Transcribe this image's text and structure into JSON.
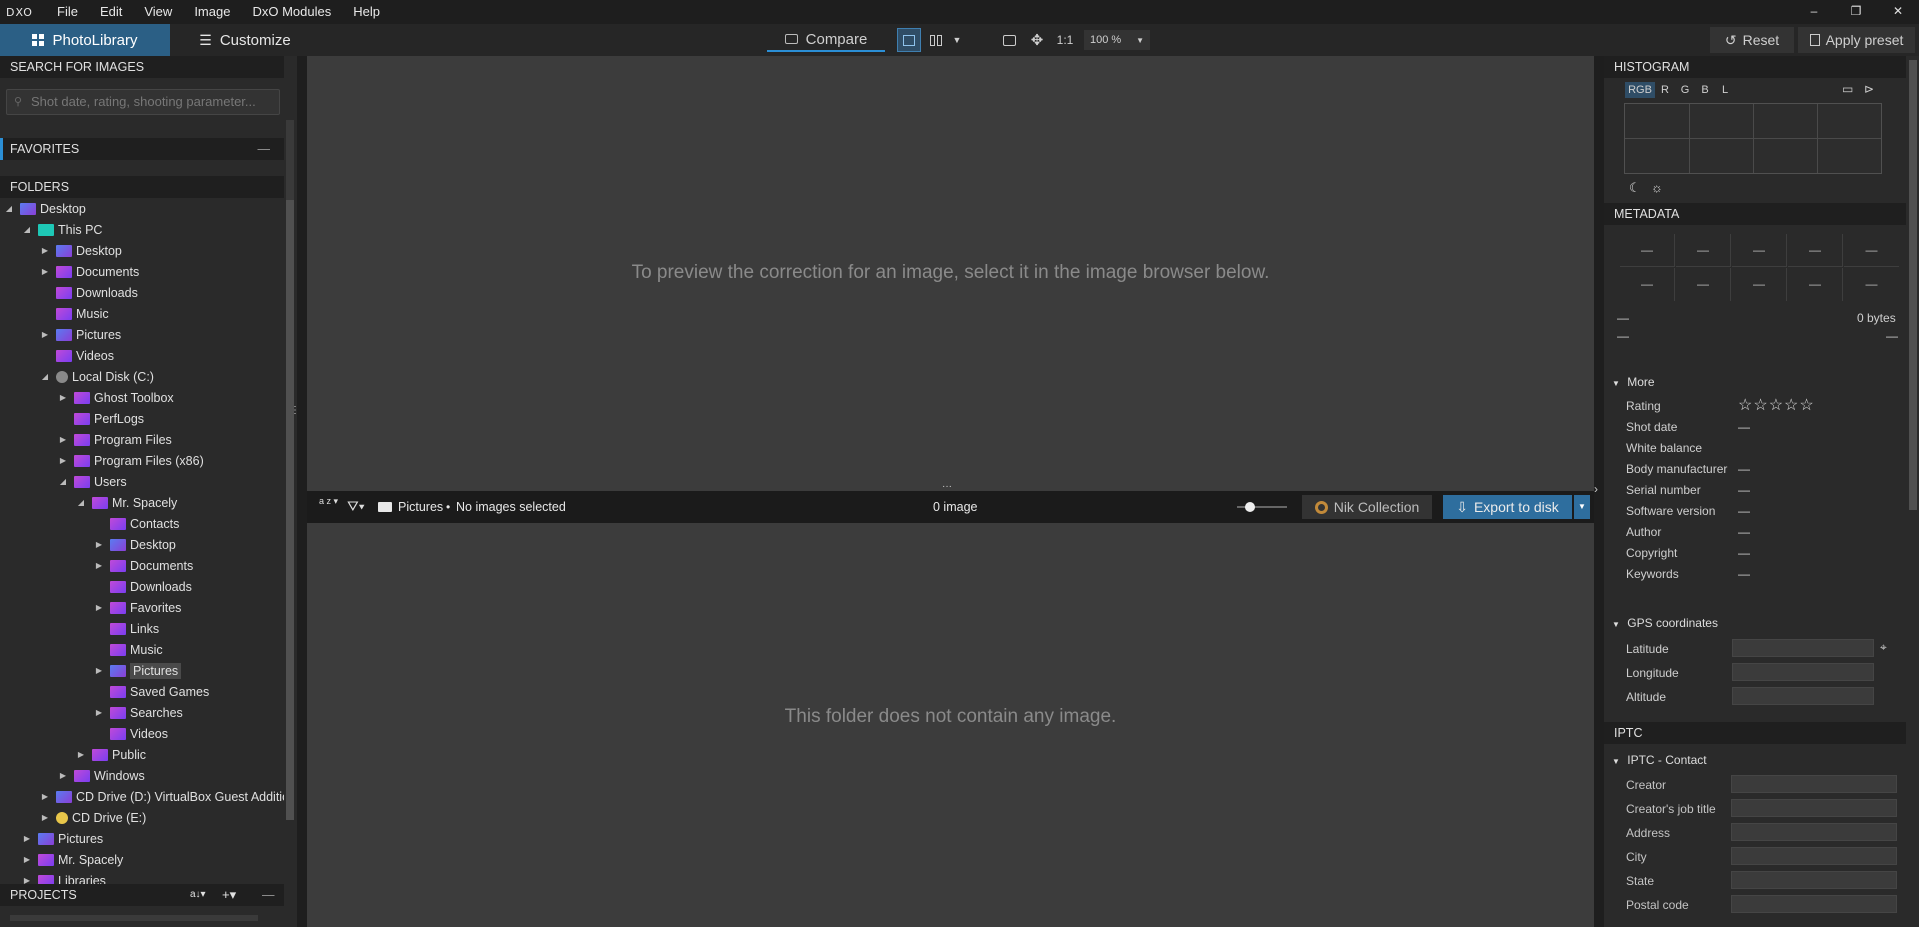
{
  "menubar": {
    "logo": "DXO",
    "items": [
      "File",
      "Edit",
      "View",
      "Image",
      "DxO Modules",
      "Help"
    ],
    "window_controls": [
      "–",
      "❐",
      "✕"
    ]
  },
  "toolbar": {
    "tab_photolibrary": "PhotoLibrary",
    "tab_customize": "Customize",
    "compare_label": "Compare",
    "zoom_one_to_one": "1:1",
    "zoom_value": "100 %",
    "reset_label": "Reset",
    "apply_preset_label": "Apply preset"
  },
  "left_panel": {
    "search_header": "SEARCH FOR IMAGES",
    "search_placeholder": "Shot date, rating, shooting parameter...",
    "favorites_header": "FAVORITES",
    "folders_header": "FOLDERS",
    "projects_header": "PROJECTS",
    "tree": [
      {
        "label": "Desktop",
        "level": 0,
        "arrow": "down",
        "icon": "blue"
      },
      {
        "label": "This PC",
        "level": 1,
        "arrow": "down",
        "icon": "teal"
      },
      {
        "label": "Desktop",
        "level": 2,
        "arrow": "right",
        "icon": "blue"
      },
      {
        "label": "Documents",
        "level": 2,
        "arrow": "right",
        "icon": "mag"
      },
      {
        "label": "Downloads",
        "level": 2,
        "arrow": "",
        "icon": "mag"
      },
      {
        "label": "Music",
        "level": 2,
        "arrow": "",
        "icon": "mag"
      },
      {
        "label": "Pictures",
        "level": 2,
        "arrow": "right",
        "icon": "blue"
      },
      {
        "label": "Videos",
        "level": 2,
        "arrow": "",
        "icon": "mag"
      },
      {
        "label": "Local Disk (C:)",
        "level": 2,
        "arrow": "down",
        "icon": "grey"
      },
      {
        "label": "Ghost Toolbox",
        "level": 3,
        "arrow": "right",
        "icon": "mag"
      },
      {
        "label": "PerfLogs",
        "level": 3,
        "arrow": "",
        "icon": "mag"
      },
      {
        "label": "Program Files",
        "level": 3,
        "arrow": "right",
        "icon": "mag"
      },
      {
        "label": "Program Files (x86)",
        "level": 3,
        "arrow": "right",
        "icon": "mag"
      },
      {
        "label": "Users",
        "level": 3,
        "arrow": "down",
        "icon": "mag"
      },
      {
        "label": "Mr. Spacely",
        "level": 4,
        "arrow": "down",
        "icon": "mag"
      },
      {
        "label": "Contacts",
        "level": 5,
        "arrow": "",
        "icon": "mag"
      },
      {
        "label": "Desktop",
        "level": 5,
        "arrow": "right",
        "icon": "blue"
      },
      {
        "label": "Documents",
        "level": 5,
        "arrow": "right",
        "icon": "mag"
      },
      {
        "label": "Downloads",
        "level": 5,
        "arrow": "",
        "icon": "mag"
      },
      {
        "label": "Favorites",
        "level": 5,
        "arrow": "right",
        "icon": "mag"
      },
      {
        "label": "Links",
        "level": 5,
        "arrow": "",
        "icon": "mag"
      },
      {
        "label": "Music",
        "level": 5,
        "arrow": "",
        "icon": "mag"
      },
      {
        "label": "Pictures",
        "level": 5,
        "arrow": "right",
        "icon": "blue",
        "selected": true
      },
      {
        "label": "Saved Games",
        "level": 5,
        "arrow": "",
        "icon": "mag"
      },
      {
        "label": "Searches",
        "level": 5,
        "arrow": "right",
        "icon": "mag"
      },
      {
        "label": "Videos",
        "level": 5,
        "arrow": "",
        "icon": "mag"
      },
      {
        "label": "Public",
        "level": 4,
        "arrow": "right",
        "icon": "mag"
      },
      {
        "label": "Windows",
        "level": 3,
        "arrow": "right",
        "icon": "mag"
      },
      {
        "label": "CD Drive (D:) VirtualBox Guest Addition",
        "level": 2,
        "arrow": "right",
        "icon": "blue"
      },
      {
        "label": "CD Drive (E:)",
        "level": 2,
        "arrow": "right",
        "icon": "gold"
      },
      {
        "label": "Pictures",
        "level": 1,
        "arrow": "right",
        "icon": "blue"
      },
      {
        "label": "Mr. Spacely",
        "level": 1,
        "arrow": "right",
        "icon": "mag"
      },
      {
        "label": "Libraries",
        "level": 1,
        "arrow": "right",
        "icon": "mag"
      }
    ]
  },
  "viewer": {
    "message": "To preview the correction for an image, select it in the image browser below."
  },
  "filmbar": {
    "sort_label": "a z",
    "folder_name": "Pictures",
    "separator": "•",
    "selection_status": "No images selected",
    "image_count": "0 image",
    "nik_label": "Nik Collection",
    "export_label": "Export to disk"
  },
  "browser": {
    "message": "This folder does not contain any image."
  },
  "right_panel": {
    "histogram_header": "HISTOGRAM",
    "hist_tabs": [
      "RGB",
      "R",
      "G",
      "B",
      "L"
    ],
    "metadata_header": "METADATA",
    "dash": "—",
    "file_size": "0 bytes",
    "more_label": "More",
    "rating_label": "Rating",
    "rating_stars": "☆☆☆☆☆",
    "more_fields": [
      "Shot date",
      "White balance",
      "Body manufacturer",
      "Serial number",
      "Software version",
      "Author",
      "Copyright",
      "Keywords"
    ],
    "gps_label": "GPS coordinates",
    "gps_fields": [
      "Latitude",
      "Longitude",
      "Altitude"
    ],
    "iptc_header": "IPTC",
    "iptc_contact_label": "IPTC - Contact",
    "iptc_fields": [
      "Creator",
      "Creator's job title",
      "Address",
      "City",
      "State",
      "Postal code"
    ]
  },
  "colors": {
    "accent_blue": "#2b5f85",
    "export_blue": "#2e6e9e",
    "selection_underline": "#2b8fd6"
  }
}
